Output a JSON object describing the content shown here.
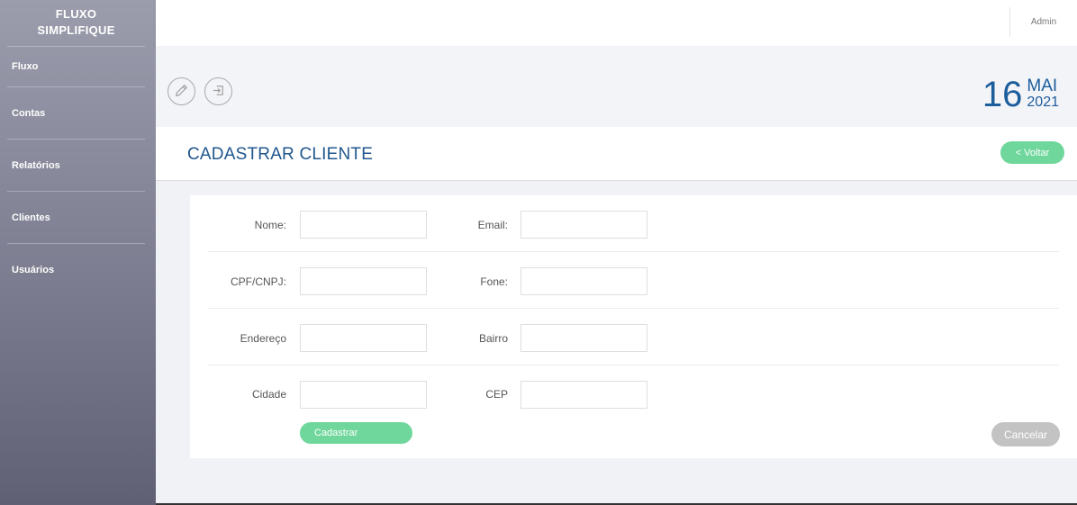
{
  "brand": {
    "line1": "FLUXO",
    "line2": "SIMPLIFIQUE"
  },
  "sidebar": {
    "items": [
      {
        "label": "Fluxo"
      },
      {
        "label": "Contas"
      },
      {
        "label": "Relatórios"
      },
      {
        "label": "Clientes"
      },
      {
        "label": "Usuários"
      }
    ]
  },
  "topbar": {
    "user": "Admin"
  },
  "actions": {
    "edit_icon": "pencil-icon",
    "logout_icon": "logout-icon"
  },
  "date": {
    "day": "16",
    "month": "MAI",
    "year": "2021"
  },
  "page": {
    "title": "CADASTRAR CLIENTE",
    "back_label": "< Voltar"
  },
  "form": {
    "nome_label": "Nome:",
    "email_label": "Email:",
    "cpf_label": "CPF/CNPJ:",
    "fone_label": "Fone:",
    "endereco_label": "Endereço",
    "bairro_label": "Bairro",
    "cidade_label": "Cidade",
    "cep_label": "CEP",
    "nome_value": "",
    "email_value": "",
    "cpf_value": "",
    "fone_value": "",
    "endereco_value": "",
    "bairro_value": "",
    "cidade_value": "",
    "cep_value": "",
    "submit_label": "Cadastrar",
    "cancel_label": "Cancelar"
  },
  "colors": {
    "accent_green": "#6fd79b",
    "title_blue": "#20578e",
    "date_blue": "#1c5d9c",
    "cancel_gray": "#c3c3c3"
  }
}
